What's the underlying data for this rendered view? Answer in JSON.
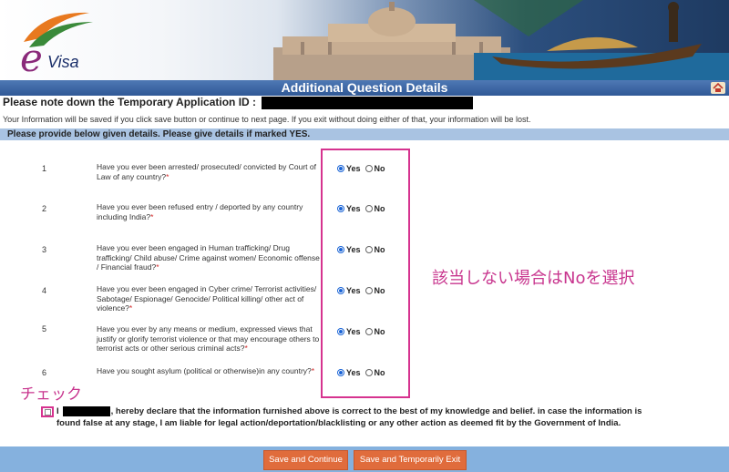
{
  "logo": {
    "text": "Visa",
    "letter": "e"
  },
  "header": {
    "title": "Additional Question Details",
    "home_icon": "home-icon"
  },
  "temp_id": {
    "label": "Please note down the Temporary Application ID :"
  },
  "info_note": "Your Information will be saved if you click save button or continue to next page. If you exit without doing either of that, your information will be lost.",
  "instruction": "Please provide below given details. Please give details if marked YES.",
  "questions": [
    {
      "num": "1",
      "text": "Have you ever been arrested/ prosecuted/ convicted by Court of Law of any country?",
      "req": "*",
      "yes": "Yes",
      "no": "No",
      "selected": "Yes"
    },
    {
      "num": "2",
      "text": "Have you ever been refused entry / deported by any country including India?",
      "req": "*",
      "yes": "Yes",
      "no": "No",
      "selected": "Yes"
    },
    {
      "num": "3",
      "text": "Have you ever been engaged in Human trafficking/ Drug trafficking/ Child abuse/ Crime against women/ Economic offense / Financial fraud?",
      "req": "*",
      "yes": "Yes",
      "no": "No",
      "selected": "Yes"
    },
    {
      "num": "4",
      "text": "Have you ever been engaged in Cyber crime/ Terrorist activities/ Sabotage/ Espionage/ Genocide/ Political killing/ other act of violence?",
      "req": "*",
      "yes": "Yes",
      "no": "No",
      "selected": "Yes"
    },
    {
      "num": "5",
      "text": "Have you ever by any means or medium, expressed views that justify or glorify terrorist violence or that may encourage others to terrorist acts or other serious criminal acts?",
      "req": "*",
      "yes": "Yes",
      "no": "No",
      "selected": "Yes"
    },
    {
      "num": "6",
      "text": "Have you sought asylum (political or otherwise)in any country?",
      "req": "*",
      "yes": "Yes",
      "no": "No",
      "selected": "Yes"
    }
  ],
  "annotations": {
    "right": "該当しない場合はNoを選択",
    "check": "チェック"
  },
  "declaration": {
    "prefix": "I",
    "text": ", hereby declare that the information furnished above is correct to the best of my knowledge and belief. in case the information is found false at any stage, I am liable for legal action/deportation/blacklisting or any other action as deemed fit by the Government of India."
  },
  "buttons": {
    "save_continue": "Save and Continue",
    "save_exit": "Save and Temporarily Exit"
  },
  "colors": {
    "accent": "#d6338f",
    "title_bar": "#2f5896",
    "button": "#e06c3c",
    "footer": "#85b1de"
  }
}
